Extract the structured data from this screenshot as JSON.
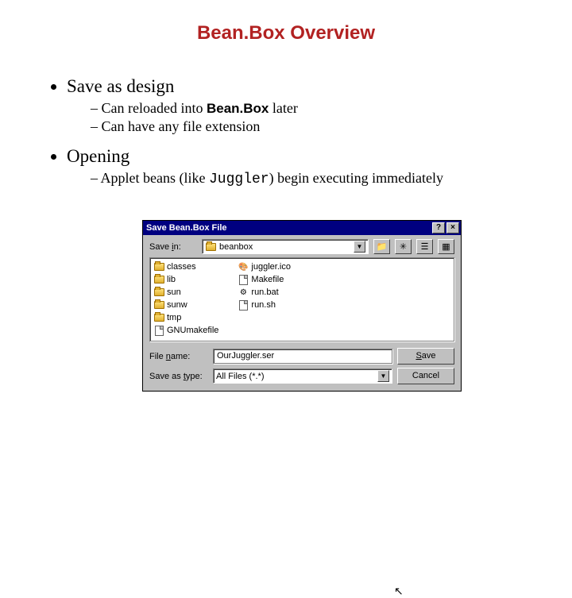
{
  "title": "Bean.Box Overview",
  "bullets": {
    "item1": {
      "label": "Save as design",
      "sub1_pre": "Can reloaded into ",
      "sub1_bold": "Bean.Box",
      "sub1_post": " later",
      "sub2": "Can have any file extension"
    },
    "item2": {
      "label": "Opening",
      "sub1_pre": "Applet beans (like ",
      "sub1_mono": "Juggler",
      "sub1_post": ") begin executing immediately"
    }
  },
  "dialog": {
    "title": "Save Bean.Box File",
    "help": "?",
    "close": "×",
    "savein_label": "Save in:",
    "savein_value": "beanbox",
    "tb": {
      "up": "▴",
      "new": "✳",
      "list": "≡",
      "detail": "▦"
    },
    "files": {
      "f0": "classes",
      "f1": "lib",
      "f2": "sun",
      "f3": "sunw",
      "f4": "tmp",
      "f5": "GNUmakefile",
      "f6": "juggler.ico",
      "f7": "Makefile",
      "f8": "run.bat",
      "f9": "run.sh"
    },
    "filename_label": "File name:",
    "filename_value": "OurJuggler.ser",
    "type_label": "Save as type:",
    "type_value": "All Files (*.*)",
    "save_btn_u": "S",
    "save_btn_r": "ave",
    "cancel_btn": "Cancel"
  }
}
